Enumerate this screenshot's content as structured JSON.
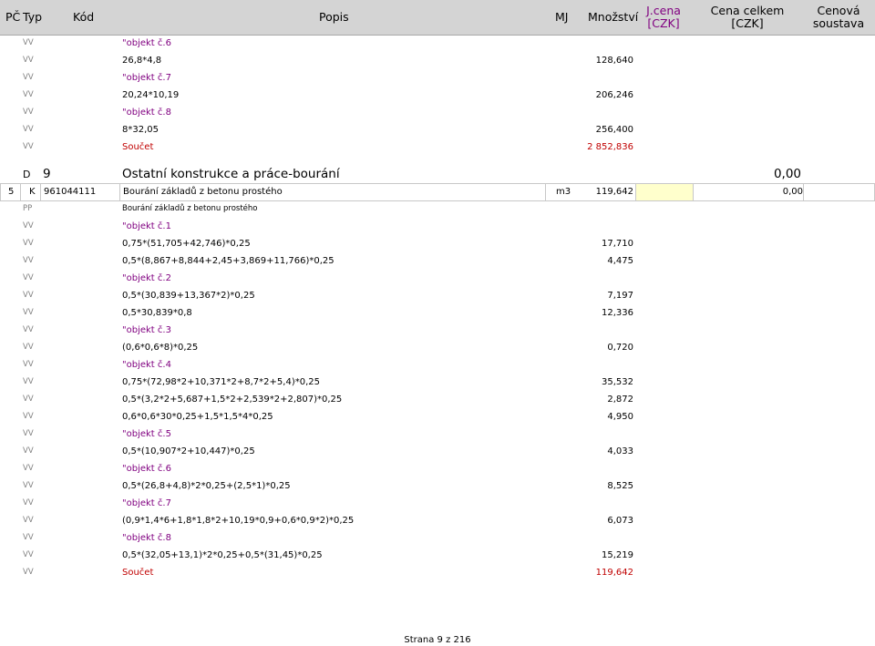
{
  "header": {
    "pc": "PČ",
    "typ": "Typ",
    "kod": "Kód",
    "popis": "Popis",
    "mj": "MJ",
    "mnozstvi": "Množství",
    "jcena_line1": "J.cena",
    "jcena_line2": "[CZK]",
    "cena_celkem_line1": "Cena celkem",
    "cena_celkem_line2": "[CZK]",
    "cenova_soustava_line1": "Cenová",
    "cenova_soustava_line2": "soustava"
  },
  "top_rows": [
    {
      "typ": "VV",
      "popis": "\"objekt č.6",
      "mnozstvi": "",
      "kind": "label"
    },
    {
      "typ": "VV",
      "popis": "26,8*4,8",
      "mnozstvi": "128,640",
      "kind": "calc"
    },
    {
      "typ": "VV",
      "popis": "\"objekt č.7",
      "mnozstvi": "",
      "kind": "label"
    },
    {
      "typ": "VV",
      "popis": "20,24*10,19",
      "mnozstvi": "206,246",
      "kind": "calc"
    },
    {
      "typ": "VV",
      "popis": "\"objekt č.8",
      "mnozstvi": "",
      "kind": "label"
    },
    {
      "typ": "VV",
      "popis": "8*32,05",
      "mnozstvi": "256,400",
      "kind": "calc"
    },
    {
      "typ": "VV",
      "popis": "Součet",
      "mnozstvi": "2 852,836",
      "kind": "sum"
    }
  ],
  "section": {
    "typ": "D",
    "kod": "9",
    "popis": "Ostatní konstrukce a práce-bourání",
    "cena_celkem": "0,00"
  },
  "item": {
    "pc": "5",
    "typ": "K",
    "kod": "961044111",
    "popis": "Bourání základů z betonu prostého",
    "mj": "m3",
    "mnozstvi": "119,642",
    "jcena": "",
    "cena_celkem": "0,00"
  },
  "item_rows": [
    {
      "typ": "PP",
      "popis": "Bourání základů z betonu prostého",
      "mnozstvi": "",
      "kind": "pp"
    },
    {
      "typ": "VV",
      "popis": "\"objekt č.1",
      "mnozstvi": "",
      "kind": "label"
    },
    {
      "typ": "VV",
      "popis": "0,75*(51,705+42,746)*0,25",
      "mnozstvi": "17,710",
      "kind": "calc"
    },
    {
      "typ": "VV",
      "popis": "0,5*(8,867+8,844+2,45+3,869+11,766)*0,25",
      "mnozstvi": "4,475",
      "kind": "calc"
    },
    {
      "typ": "VV",
      "popis": "\"objekt č.2",
      "mnozstvi": "",
      "kind": "label"
    },
    {
      "typ": "VV",
      "popis": "0,5*(30,839+13,367*2)*0,25",
      "mnozstvi": "7,197",
      "kind": "calc"
    },
    {
      "typ": "VV",
      "popis": "0,5*30,839*0,8",
      "mnozstvi": "12,336",
      "kind": "calc"
    },
    {
      "typ": "VV",
      "popis": "\"objekt č.3",
      "mnozstvi": "",
      "kind": "label"
    },
    {
      "typ": "VV",
      "popis": "(0,6*0,6*8)*0,25",
      "mnozstvi": "0,720",
      "kind": "calc"
    },
    {
      "typ": "VV",
      "popis": "\"objekt č.4",
      "mnozstvi": "",
      "kind": "label"
    },
    {
      "typ": "VV",
      "popis": "0,75*(72,98*2+10,371*2+8,7*2+5,4)*0,25",
      "mnozstvi": "35,532",
      "kind": "calc"
    },
    {
      "typ": "VV",
      "popis": "0,5*(3,2*2+5,687+1,5*2+2,539*2+2,807)*0,25",
      "mnozstvi": "2,872",
      "kind": "calc"
    },
    {
      "typ": "VV",
      "popis": "0,6*0,6*30*0,25+1,5*1,5*4*0,25",
      "mnozstvi": "4,950",
      "kind": "calc"
    },
    {
      "typ": "VV",
      "popis": "\"objekt č.5",
      "mnozstvi": "",
      "kind": "label"
    },
    {
      "typ": "VV",
      "popis": "0,5*(10,907*2+10,447)*0,25",
      "mnozstvi": "4,033",
      "kind": "calc"
    },
    {
      "typ": "VV",
      "popis": "\"objekt č.6",
      "mnozstvi": "",
      "kind": "label"
    },
    {
      "typ": "VV",
      "popis": "0,5*(26,8+4,8)*2*0,25+(2,5*1)*0,25",
      "mnozstvi": "8,525",
      "kind": "calc"
    },
    {
      "typ": "VV",
      "popis": "\"objekt č.7",
      "mnozstvi": "",
      "kind": "label"
    },
    {
      "typ": "VV",
      "popis": "(0,9*1,4*6+1,8*1,8*2+10,19*0,9+0,6*0,9*2)*0,25",
      "mnozstvi": "6,073",
      "kind": "calc"
    },
    {
      "typ": "VV",
      "popis": "\"objekt č.8",
      "mnozstvi": "",
      "kind": "label"
    },
    {
      "typ": "VV",
      "popis": "0,5*(32,05+13,1)*2*0,25+0,5*(31,45)*0,25",
      "mnozstvi": "15,219",
      "kind": "calc"
    },
    {
      "typ": "VV",
      "popis": "Součet",
      "mnozstvi": "119,642",
      "kind": "sum"
    }
  ],
  "footer": {
    "page_label": "Strana 9 z 216"
  }
}
